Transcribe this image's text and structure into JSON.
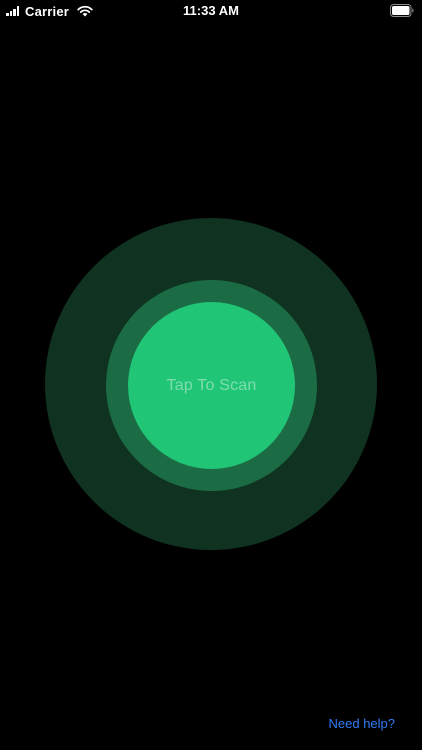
{
  "status_bar": {
    "carrier": "Carrier",
    "time": "11:33 AM",
    "icons": {
      "signal": "signal-bars-icon",
      "wifi": "wifi-icon",
      "battery": "battery-icon"
    }
  },
  "scanner": {
    "button_label": "Tap To Scan",
    "colors": {
      "outer_ring": "#0f3320",
      "middle_ring": "#1b6b44",
      "inner_button": "#21c576"
    }
  },
  "footer": {
    "help_label": "Need help?",
    "link_color": "#2f7df6"
  }
}
